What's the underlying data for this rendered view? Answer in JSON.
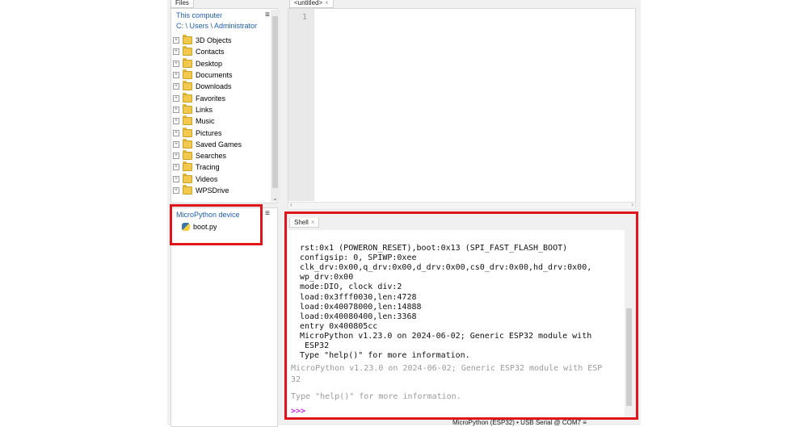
{
  "tabs": {
    "files": "Files",
    "editor": "<untitled>",
    "shell": "Shell",
    "close_glyph": "×"
  },
  "files": {
    "this_computer_label": "This computer",
    "path": "C: \\ Users \\ Administrator",
    "menu_glyph": "≡",
    "folders": [
      "3D Objects",
      "Contacts",
      "Desktop",
      "Documents",
      "Downloads",
      "Favorites",
      "Links",
      "Music",
      "Pictures",
      "Saved Games",
      "Searches",
      "Tracing",
      "Videos",
      "WPSDrive"
    ],
    "device_label": "MicroPython device",
    "device_files": [
      "boot.py"
    ]
  },
  "editor": {
    "line_number": "1"
  },
  "shell": {
    "boot_lines": [
      "rst:0x1 (POWERON_RESET),boot:0x13 (SPI_FAST_FLASH_BOOT)",
      "configsip: 0, SPIWP:0xee",
      "clk_drv:0x00,q_drv:0x00,d_drv:0x00,cs0_drv:0x00,hd_drv:0x00,",
      "wp_drv:0x00",
      "mode:DIO, clock div:2",
      "load:0x3fff0030,len:4728",
      "load:0x40078000,len:14888",
      "load:0x40080400,len:3368",
      "entry 0x400805cc",
      "MicroPython v1.23.0 on 2024-06-02; Generic ESP32 module with",
      " ESP32",
      "Type \"help()\" for more information."
    ],
    "banner_line1": "MicroPython v1.23.0 on 2024-06-02; Generic ESP32 module with ESP",
    "banner_line2": "32",
    "banner_help": "Type \"help()\" for more information.",
    "prompt": ">>>"
  },
  "status_bar": {
    "text": "MicroPython (ESP32)  •  USB Serial @ COM7  ≡"
  },
  "colors": {
    "highlight_box": "#e0141b",
    "link_blue": "#1f5fb4",
    "prompt": "#c026d3"
  }
}
